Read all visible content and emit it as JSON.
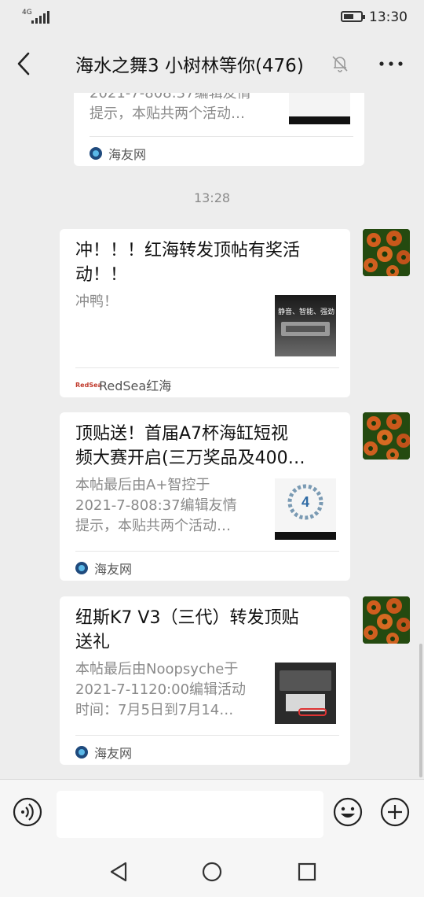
{
  "status": {
    "network": "4G",
    "time": "13:30"
  },
  "header": {
    "title": "海水之舞3 小树林等你(476)"
  },
  "messages": [
    {
      "partial": true,
      "title": "",
      "desc_lines": [
        "2021-7-808:37编辑友情",
        "提示，本贴共两个活动…"
      ],
      "source": "海友网"
    },
    {
      "title_lines": [
        "冲！！！红海转发顶帖有奖活",
        "动！！"
      ],
      "desc_lines": [
        "冲鸭！"
      ],
      "thumb_text": "静音、智能、强劲",
      "source": "RedSea红海",
      "source_logo": "RedSea"
    },
    {
      "title_lines": [
        "顶贴送！首届A7杯海缸短视",
        "频大赛开启(三万奖品及400…"
      ],
      "desc_lines": [
        "本帖最后由A+智控于",
        "2021-7-808:37编辑友情",
        "提示，本贴共两个活动…"
      ],
      "source": "海友网"
    },
    {
      "title_lines": [
        "纽斯K7 V3（三代）转发顶贴",
        "送礼"
      ],
      "desc_lines": [
        "本帖最后由Noopsyche于",
        "2021-7-1120:00编辑活动",
        "时间：7月5日到7月14…"
      ],
      "source": "海友网"
    }
  ],
  "timestamp": "13:28",
  "icons": {
    "back": "back-arrow-icon",
    "mute": "mute-bell-icon",
    "more": "more-dots-icon",
    "voice": "voice-icon",
    "emoji": "emoji-icon",
    "plus": "plus-icon"
  }
}
